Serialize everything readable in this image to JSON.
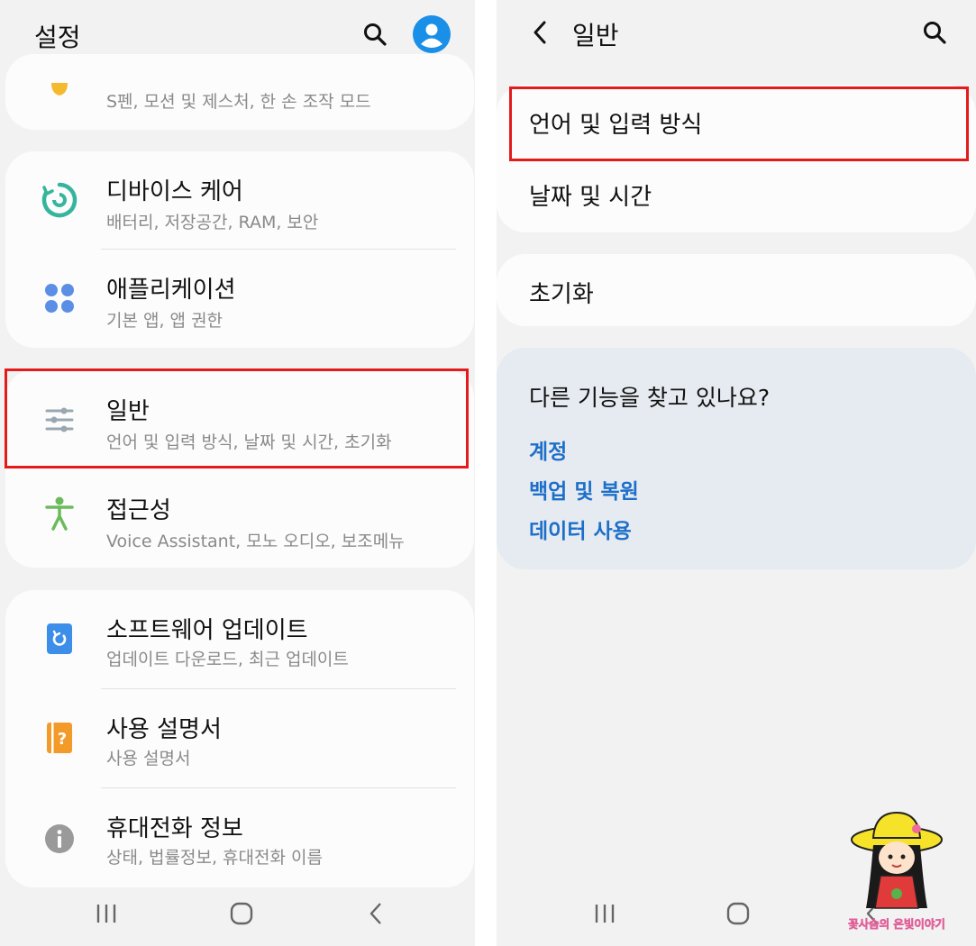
{
  "left": {
    "title": "설정",
    "partial_item": {
      "sub": "S펜, 모션 및 제스처, 한 손 조작 모드"
    },
    "items": [
      {
        "title": "디바이스 케어",
        "sub": "배터리, 저장공간, RAM, 보안",
        "icon": "device-care-icon",
        "color": "#36b59d"
      },
      {
        "title": "애플리케이션",
        "sub": "기본 앱, 앱 권한",
        "icon": "apps-icon",
        "color": "#5b8fe6"
      },
      {
        "title": "일반",
        "sub": "언어 및 입력 방식, 날짜 및 시간, 초기화",
        "icon": "general-sliders-icon",
        "color": "#9aa7b0"
      },
      {
        "title": "접근성",
        "sub": "Voice Assistant, 모노 오디오, 보조메뉴",
        "icon": "accessibility-icon",
        "color": "#6bbb5c"
      },
      {
        "title": "소프트웨어 업데이트",
        "sub": "업데이트 다운로드, 최근 업데이트",
        "icon": "software-update-icon",
        "color": "#3d8ee8"
      },
      {
        "title": "사용 설명서",
        "sub": "사용 설명서",
        "icon": "manual-icon",
        "color": "#f39b2a"
      },
      {
        "title": "휴대전화 정보",
        "sub": "상태, 법률정보, 휴대전화 이름",
        "icon": "info-icon",
        "color": "#9a9a9a"
      }
    ]
  },
  "right": {
    "title": "일반",
    "items": [
      {
        "title": "언어 및 입력 방식"
      },
      {
        "title": "날짜 및 시간"
      },
      {
        "title": "초기화"
      }
    ],
    "suggestion": {
      "question": "다른 기능을 찾고 있나요?",
      "links": [
        "계정",
        "백업 및 복원",
        "데이터 사용"
      ]
    }
  },
  "watermark": "꽃사슴의 은빛이야기",
  "colors": {
    "highlight": "#e41b1b",
    "link": "#1d6fc9",
    "account": "#1a8fe8",
    "background": "#f2f2f2"
  }
}
